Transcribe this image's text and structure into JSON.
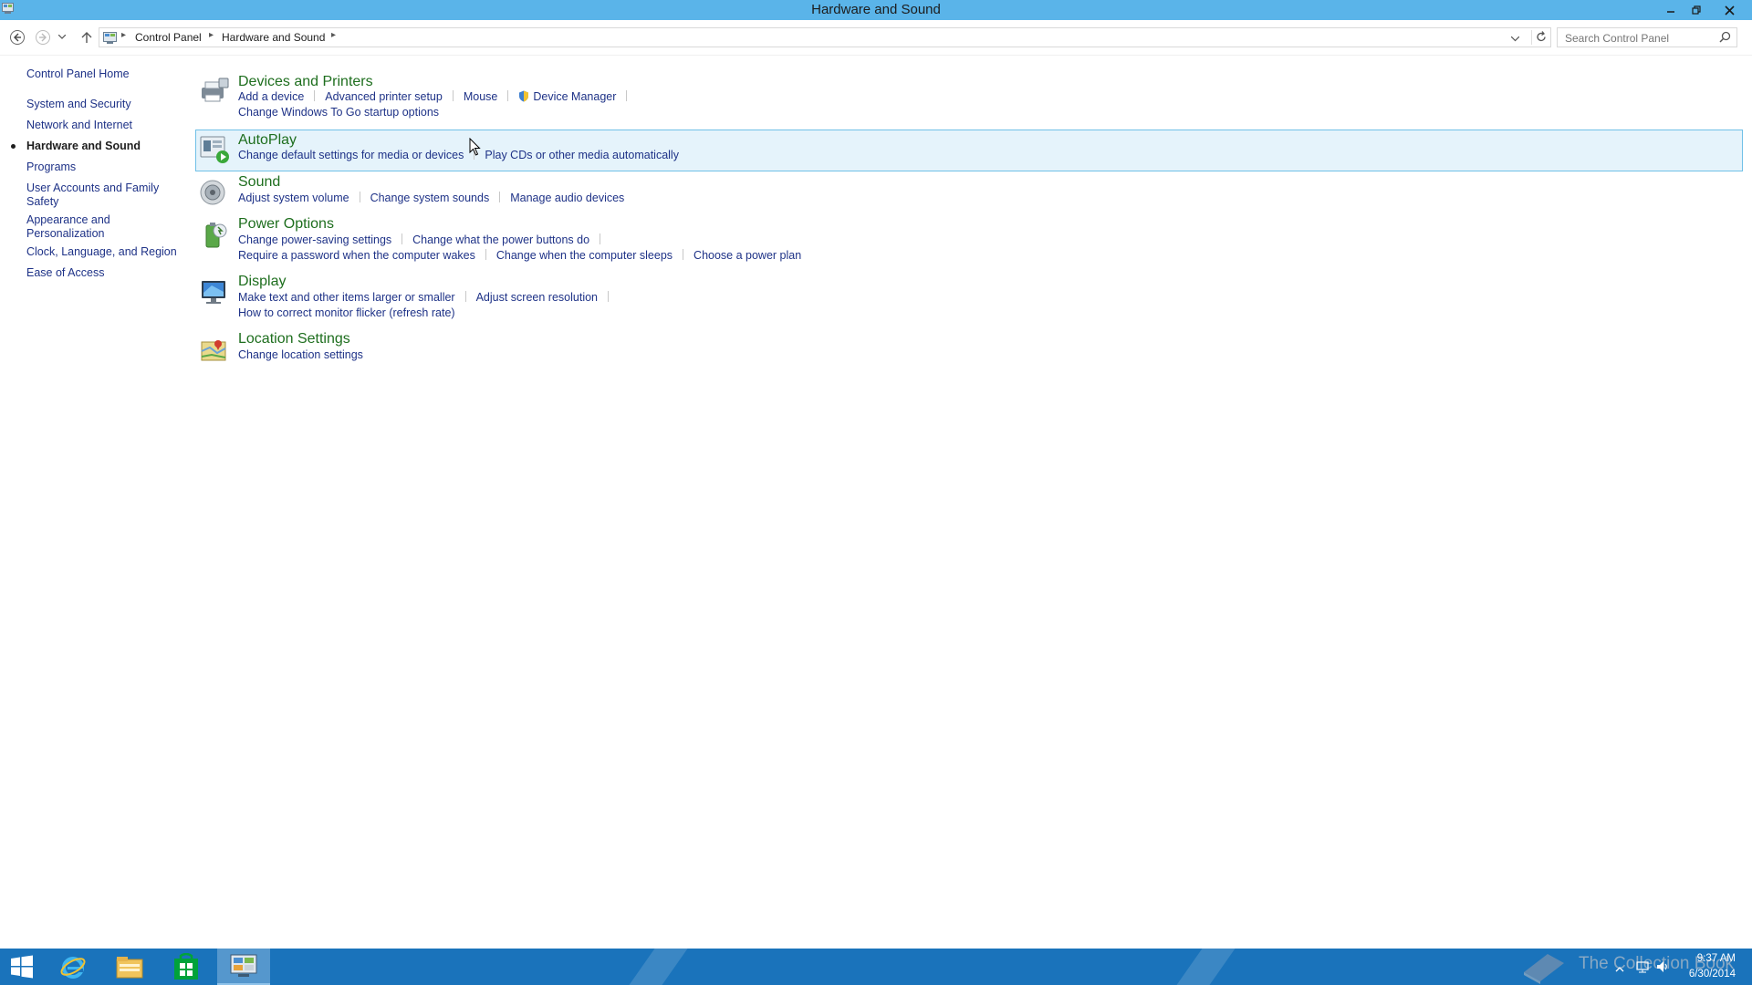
{
  "window": {
    "title": "Hardware and Sound"
  },
  "address": {
    "crumbs": [
      "Control Panel",
      "Hardware and Sound"
    ],
    "search_placeholder": "Search Control Panel"
  },
  "sidebar": {
    "home": "Control Panel Home",
    "items": [
      {
        "label": "System and Security"
      },
      {
        "label": "Network and Internet"
      },
      {
        "label": "Hardware and Sound",
        "active": true
      },
      {
        "label": "Programs"
      },
      {
        "label": "User Accounts and Family Safety"
      },
      {
        "label": "Appearance and Personalization"
      },
      {
        "label": "Clock, Language, and Region"
      },
      {
        "label": "Ease of Access"
      }
    ]
  },
  "categories": [
    {
      "title": "Devices and Printers",
      "icon": "printer-icon",
      "links": [
        [
          "Add a device",
          "Advanced printer setup",
          "Mouse",
          "Device Manager"
        ],
        [
          "Change Windows To Go startup options"
        ]
      ]
    },
    {
      "title": "AutoPlay",
      "icon": "autoplay-icon",
      "links": [
        [
          "Change default settings for media or devices",
          "Play CDs or other media automatically"
        ]
      ]
    },
    {
      "title": "Sound",
      "icon": "speaker-icon",
      "links": [
        [
          "Adjust system volume",
          "Change system sounds",
          "Manage audio devices"
        ]
      ]
    },
    {
      "title": "Power Options",
      "icon": "battery-icon",
      "links": [
        [
          "Change power-saving settings",
          "Change what the power buttons do"
        ],
        [
          "Require a password when the computer wakes",
          "Change when the computer sleeps",
          "Choose a power plan"
        ]
      ]
    },
    {
      "title": "Display",
      "icon": "monitor-icon",
      "links": [
        [
          "Make text and other items larger or smaller",
          "Adjust screen resolution"
        ],
        [
          "How to correct monitor flicker (refresh rate)"
        ]
      ]
    },
    {
      "title": "Location Settings",
      "icon": "location-icon",
      "links": [
        [
          "Change location settings"
        ]
      ]
    }
  ],
  "taskbar": {
    "time": "9:37 AM",
    "date": "6/30/2014",
    "watermark": "The Collection Book"
  },
  "colors": {
    "titlebar": "#5ab4e9",
    "link": "#1e3287",
    "category_title": "#1e6e1e",
    "taskbar": "#1a73bb",
    "hover_bg": "#e5f3fb"
  }
}
